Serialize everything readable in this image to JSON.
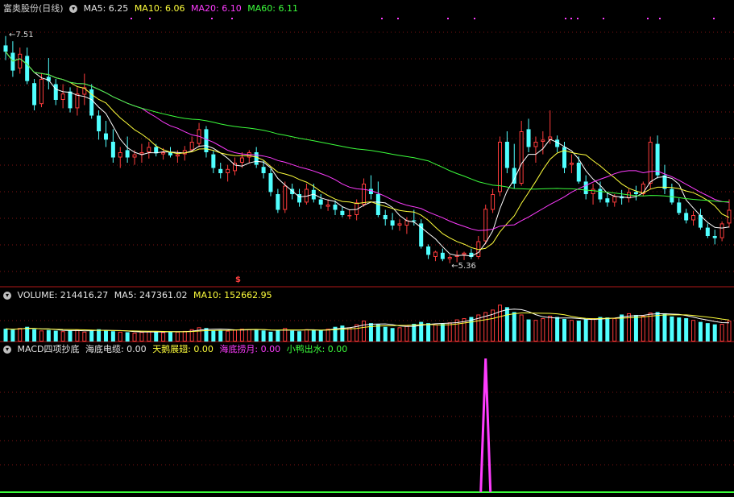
{
  "main_header": {
    "symbol": "富奥股份(日线)",
    "ma5": "MA5: 6.25",
    "ma10": "MA10: 6.06",
    "ma20": "MA20: 6.10",
    "ma60": "MA60: 6.11"
  },
  "volume_header": {
    "volume": "VOLUME: 214416.27",
    "ma5": "MA5: 247361.02",
    "ma10": "MA10: 152662.95"
  },
  "macd_header": {
    "name": "MACD四项抄底",
    "i1": "海底电缆: 0.00",
    "i2": "天鹅展翅: 0.00",
    "i3": "海底捞月: 0.00",
    "i4": "小鸭出水: 0.00"
  },
  "annotations": {
    "high": "7.51",
    "low": "5.36",
    "marker": "$"
  },
  "colors": {
    "up": "#ff3c3c",
    "down": "#50ffff",
    "ma5": "#ffffff",
    "ma10": "#ffff3c",
    "ma20": "#ff3cff",
    "ma60": "#3cff3c",
    "grid": "#7a1212",
    "divider": "#b01818"
  },
  "chart_data": {
    "type": "candlestick",
    "candles": [
      [
        7.42,
        7.51,
        7.28,
        7.36
      ],
      [
        7.35,
        7.46,
        7.12,
        7.18
      ],
      [
        7.2,
        7.4,
        7.15,
        7.34
      ],
      [
        7.32,
        7.4,
        7.05,
        7.08
      ],
      [
        7.06,
        7.1,
        6.8,
        6.85
      ],
      [
        6.86,
        7.15,
        6.83,
        7.1
      ],
      [
        7.12,
        7.3,
        7.0,
        7.08
      ],
      [
        7.05,
        7.1,
        6.85,
        6.9
      ],
      [
        6.9,
        7.05,
        6.82,
        6.96
      ],
      [
        6.98,
        7.02,
        6.78,
        6.82
      ],
      [
        6.82,
        7.02,
        6.75,
        6.96
      ],
      [
        6.95,
        7.15,
        6.85,
        7.02
      ],
      [
        7.0,
        7.05,
        6.72,
        6.75
      ],
      [
        6.75,
        6.8,
        6.52,
        6.6
      ],
      [
        6.58,
        6.7,
        6.45,
        6.52
      ],
      [
        6.5,
        6.62,
        6.3,
        6.35
      ],
      [
        6.35,
        6.45,
        6.25,
        6.4
      ],
      [
        6.42,
        6.55,
        6.3,
        6.35
      ],
      [
        6.35,
        6.42,
        6.28,
        6.38
      ],
      [
        6.38,
        6.48,
        6.3,
        6.4
      ],
      [
        6.4,
        6.5,
        6.34,
        6.45
      ],
      [
        6.45,
        6.48,
        6.36,
        6.39
      ],
      [
        6.38,
        6.44,
        6.33,
        6.4
      ],
      [
        6.4,
        6.45,
        6.35,
        6.37
      ],
      [
        6.36,
        6.42,
        6.3,
        6.38
      ],
      [
        6.38,
        6.46,
        6.32,
        6.42
      ],
      [
        6.42,
        6.55,
        6.4,
        6.5
      ],
      [
        6.48,
        6.68,
        6.45,
        6.62
      ],
      [
        6.62,
        6.65,
        6.35,
        6.4
      ],
      [
        6.38,
        6.42,
        6.2,
        6.25
      ],
      [
        6.24,
        6.3,
        6.15,
        6.2
      ],
      [
        6.2,
        6.28,
        6.12,
        6.24
      ],
      [
        6.22,
        6.35,
        6.18,
        6.3
      ],
      [
        6.3,
        6.4,
        6.25,
        6.35
      ],
      [
        6.35,
        6.42,
        6.3,
        6.4
      ],
      [
        6.4,
        6.45,
        6.25,
        6.28
      ],
      [
        6.26,
        6.32,
        6.15,
        6.2
      ],
      [
        6.2,
        6.24,
        5.98,
        6.02
      ],
      [
        6.0,
        6.05,
        5.82,
        5.85
      ],
      [
        5.85,
        6.12,
        5.82,
        6.08
      ],
      [
        6.05,
        6.1,
        5.95,
        6.0
      ],
      [
        6.0,
        6.05,
        5.88,
        5.92
      ],
      [
        5.92,
        6.1,
        5.9,
        6.05
      ],
      [
        6.04,
        6.1,
        5.92,
        5.95
      ],
      [
        5.95,
        6.0,
        5.86,
        5.9
      ],
      [
        5.88,
        5.95,
        5.84,
        5.9
      ],
      [
        5.9,
        5.94,
        5.8,
        5.85
      ],
      [
        5.84,
        5.88,
        5.78,
        5.8
      ],
      [
        5.8,
        5.85,
        5.76,
        5.8
      ],
      [
        5.8,
        5.95,
        5.75,
        5.92
      ],
      [
        5.9,
        6.15,
        5.88,
        6.1
      ],
      [
        6.05,
        6.18,
        5.95,
        6.0
      ],
      [
        6.0,
        6.12,
        5.78,
        5.8
      ],
      [
        5.8,
        5.85,
        5.7,
        5.76
      ],
      [
        5.75,
        5.82,
        5.66,
        5.7
      ],
      [
        5.7,
        5.76,
        5.65,
        5.72
      ],
      [
        5.7,
        5.78,
        5.62,
        5.75
      ],
      [
        5.75,
        5.85,
        5.7,
        5.74
      ],
      [
        5.72,
        5.76,
        5.48,
        5.5
      ],
      [
        5.5,
        5.52,
        5.38,
        5.42
      ],
      [
        5.4,
        5.46,
        5.36,
        5.45
      ],
      [
        5.44,
        5.48,
        5.36,
        5.38
      ],
      [
        5.38,
        5.42,
        5.34,
        5.4
      ],
      [
        5.4,
        5.46,
        5.35,
        5.42
      ],
      [
        5.42,
        5.45,
        5.37,
        5.44
      ],
      [
        5.44,
        5.48,
        5.38,
        5.4
      ],
      [
        5.4,
        5.6,
        5.38,
        5.55
      ],
      [
        5.55,
        5.9,
        5.52,
        5.86
      ],
      [
        5.85,
        6.05,
        5.82,
        6.0
      ],
      [
        6.02,
        6.55,
        5.98,
        6.5
      ],
      [
        6.5,
        6.6,
        6.2,
        6.25
      ],
      [
        6.25,
        6.48,
        6.05,
        6.1
      ],
      [
        6.1,
        6.7,
        6.08,
        6.6
      ],
      [
        6.62,
        6.72,
        6.4,
        6.45
      ],
      [
        6.45,
        6.55,
        6.3,
        6.5
      ],
      [
        6.5,
        6.6,
        6.38,
        6.52
      ],
      [
        6.52,
        6.8,
        6.48,
        6.55
      ],
      [
        6.52,
        6.56,
        6.4,
        6.45
      ],
      [
        6.45,
        6.5,
        6.2,
        6.25
      ],
      [
        6.28,
        6.38,
        6.2,
        6.3
      ],
      [
        6.3,
        6.36,
        6.1,
        6.12
      ],
      [
        6.12,
        6.18,
        5.95,
        6.0
      ],
      [
        6.0,
        6.1,
        5.9,
        6.05
      ],
      [
        6.05,
        6.12,
        5.92,
        5.95
      ],
      [
        5.96,
        6.02,
        5.88,
        5.92
      ],
      [
        5.92,
        6.0,
        5.88,
        5.98
      ],
      [
        5.98,
        6.04,
        5.9,
        5.96
      ],
      [
        5.96,
        6.05,
        5.92,
        6.02
      ],
      [
        6.02,
        6.08,
        5.94,
        6.0
      ],
      [
        6.0,
        6.12,
        5.98,
        6.1
      ],
      [
        6.1,
        6.55,
        6.05,
        6.5
      ],
      [
        6.48,
        6.56,
        6.15,
        6.18
      ],
      [
        6.18,
        6.28,
        6.0,
        6.05
      ],
      [
        6.05,
        6.1,
        5.9,
        5.92
      ],
      [
        5.92,
        5.96,
        5.8,
        5.82
      ],
      [
        5.82,
        5.86,
        5.72,
        5.75
      ],
      [
        5.75,
        5.84,
        5.7,
        5.8
      ],
      [
        5.8,
        5.86,
        5.66,
        5.68
      ],
      [
        5.68,
        5.72,
        5.58,
        5.6
      ],
      [
        5.6,
        5.66,
        5.52,
        5.58
      ],
      [
        5.58,
        5.74,
        5.55,
        5.72
      ],
      [
        5.72,
        5.95,
        5.68,
        5.85
      ]
    ],
    "volume": [
      52,
      48,
      55,
      60,
      50,
      45,
      47,
      44,
      42,
      45,
      48,
      40,
      46,
      50,
      45,
      42,
      40,
      38,
      36,
      39,
      42,
      40,
      38,
      41,
      40,
      43,
      50,
      58,
      55,
      46,
      45,
      44,
      48,
      52,
      50,
      47,
      45,
      40,
      48,
      55,
      44,
      42,
      50,
      48,
      46,
      52,
      60,
      65,
      58,
      70,
      85,
      75,
      70,
      60,
      55,
      58,
      65,
      72,
      80,
      75,
      70,
      72,
      78,
      90,
      95,
      100,
      110,
      120,
      130,
      150,
      140,
      120,
      110,
      90,
      88,
      95,
      105,
      100,
      92,
      88,
      85,
      90,
      95,
      100,
      98,
      95,
      110,
      115,
      108,
      105,
      118,
      120,
      115,
      102,
      98,
      95,
      88,
      80,
      75,
      70,
      72,
      85
    ],
    "ylim": [
      5.2,
      7.7
    ],
    "high_label": "7.51",
    "low_label": "5.36",
    "signal": {
      "series": "海底捞月",
      "index": 67,
      "value": 1
    }
  }
}
